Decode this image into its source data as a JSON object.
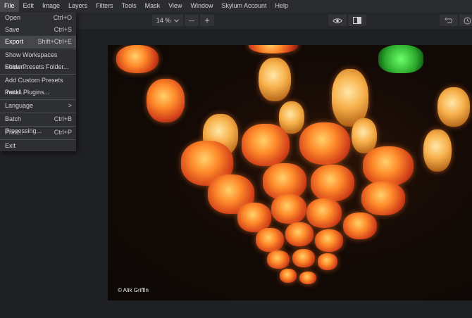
{
  "menubar": {
    "items": [
      "File",
      "Edit",
      "Image",
      "Layers",
      "Filters",
      "Tools",
      "Mask",
      "View",
      "Window",
      "Skylum Account",
      "Help"
    ]
  },
  "toolbar": {
    "zoom": "14 %",
    "zoom_out_symbol": "—",
    "zoom_in_symbol": "+"
  },
  "file_menu": {
    "items": [
      {
        "label": "Open",
        "shortcut": "Ctrl+O"
      },
      {
        "label": "Save",
        "shortcut": "Ctrl+S"
      },
      {
        "label": "Export",
        "shortcut": "Shift+Ctrl+E"
      },
      {
        "label": "Show Workspaces Folder...",
        "shortcut": ""
      },
      {
        "label": "Show Presets Folder...",
        "shortcut": ""
      },
      {
        "label": "Add Custom Presets Pack...",
        "shortcut": ""
      },
      {
        "label": "Install Plugins...",
        "shortcut": ""
      },
      {
        "label": "Language",
        "shortcut": ">"
      },
      {
        "label": "Batch Processing...",
        "shortcut": "Ctrl+B"
      },
      {
        "label": "Print...",
        "shortcut": "Ctrl+P"
      },
      {
        "label": "Exit",
        "shortcut": ""
      }
    ]
  },
  "photo": {
    "credit": "© Alik Griffin"
  },
  "icons": {
    "dropdown": "chevron-down-icon",
    "preview": "eye-icon",
    "compare": "compare-icon",
    "undo": "undo-icon",
    "history": "history-icon"
  }
}
